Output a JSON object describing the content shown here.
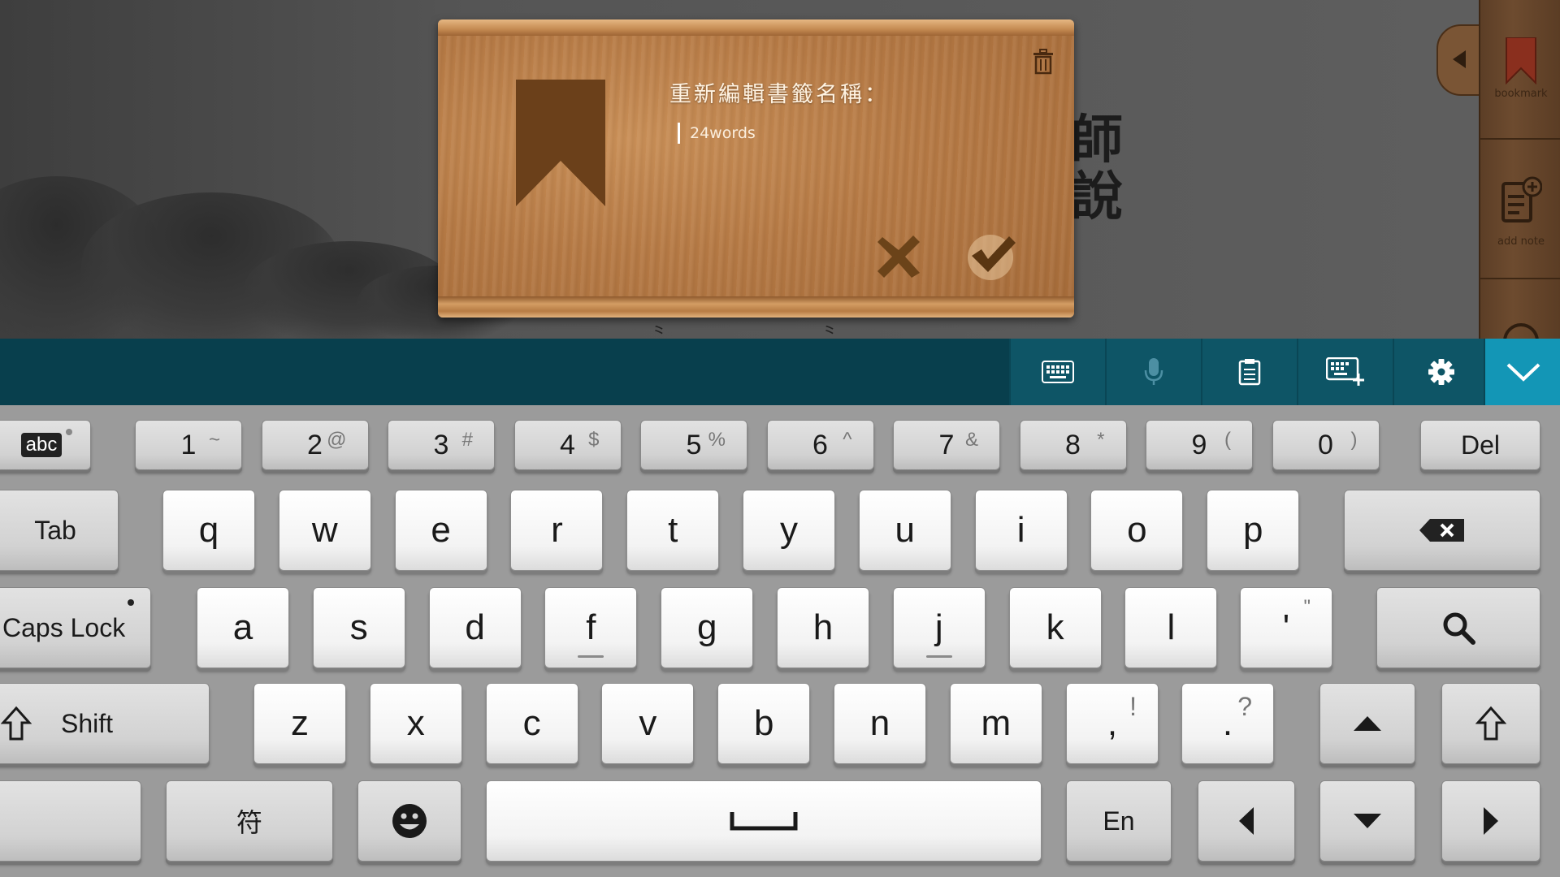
{
  "dialog": {
    "title": "重新編輯書籤名稱：",
    "name_value": "24words"
  },
  "side_toolbar": {
    "bookmark_label": "bookmark",
    "add_note_label": "add note"
  },
  "background": {
    "calligraphy": "師說"
  },
  "keyboard": {
    "mode_label": "abc",
    "row_numbers": [
      {
        "main": "1",
        "sub": "~"
      },
      {
        "main": "2",
        "sub": "@"
      },
      {
        "main": "3",
        "sub": "#"
      },
      {
        "main": "4",
        "sub": "$"
      },
      {
        "main": "5",
        "sub": "%"
      },
      {
        "main": "6",
        "sub": "^"
      },
      {
        "main": "7",
        "sub": "&"
      },
      {
        "main": "8",
        "sub": "*"
      },
      {
        "main": "9",
        "sub": "("
      },
      {
        "main": "0",
        "sub": ")"
      }
    ],
    "del_label": "Del",
    "tab_label": "Tab",
    "row_q": [
      "q",
      "w",
      "e",
      "r",
      "t",
      "y",
      "u",
      "i",
      "o",
      "p"
    ],
    "caps_label": "Caps Lock",
    "row_a": [
      "a",
      "s",
      "d",
      "f",
      "g",
      "h",
      "j",
      "k",
      "l"
    ],
    "quote_key": {
      "main": "'",
      "sub": "\""
    },
    "shift_label": "Shift",
    "row_z": [
      "z",
      "x",
      "c",
      "v",
      "b",
      "n",
      "m"
    ],
    "comma_key": {
      "main": ",",
      "sub": "!"
    },
    "period_key": {
      "main": ".",
      "sub": "?"
    },
    "symbol_label": "符",
    "lang_label": "En"
  }
}
